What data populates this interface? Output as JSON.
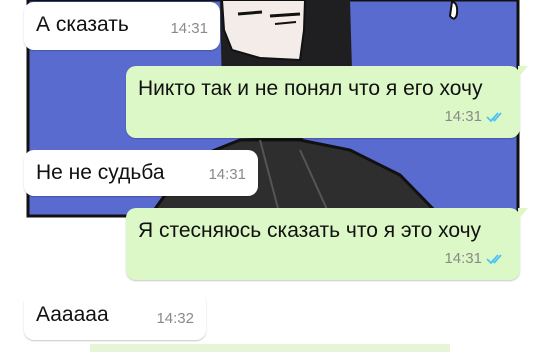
{
  "chat": {
    "messages": [
      {
        "direction": "in",
        "text": "А сказать",
        "time": "14:31"
      },
      {
        "direction": "out",
        "text": "Никто так и не понял что я его хочу",
        "time": "14:31",
        "read": true
      },
      {
        "direction": "in",
        "text": "Не не судьба",
        "time": "14:31"
      },
      {
        "direction": "out",
        "text": "Я стесняюсь сказать что я это хочу",
        "time": "14:31",
        "read": true
      },
      {
        "direction": "in",
        "text": "Аааааа",
        "time": "14:32"
      }
    ]
  },
  "colors": {
    "incoming_bubble": "#ffffff",
    "outgoing_bubble": "#dcf8c6",
    "read_ticks": "#4fc3f7",
    "wallpaper_blue": "#5a6bd0"
  },
  "icons": {
    "read_receipt": "double-check-icon"
  }
}
